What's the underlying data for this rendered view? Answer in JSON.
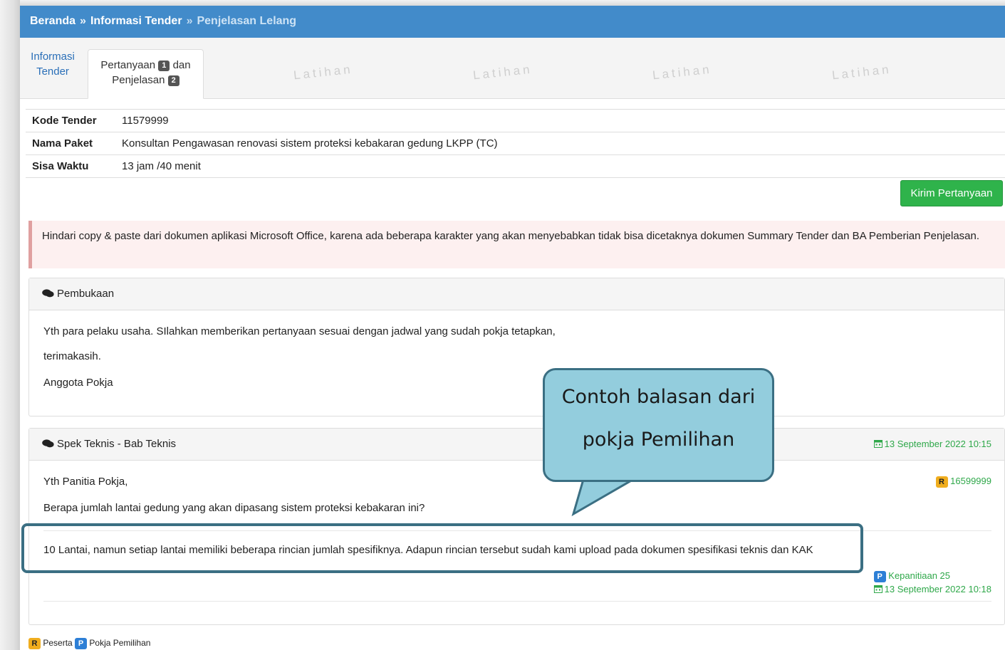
{
  "breadcrumb": {
    "home": "Beranda",
    "sep": "»",
    "section": "Informasi Tender",
    "current": "Penjelasan Lelang"
  },
  "tabs": {
    "info_line1": "Informasi",
    "info_line2": "Tender",
    "qa_part1": "Pertanyaan",
    "qa_badge1": "1",
    "qa_part2": "dan",
    "qa_part3": "Penjelasan",
    "qa_badge2": "2"
  },
  "watermark": "Latihan",
  "tender": {
    "rows": [
      {
        "key": "Kode Tender",
        "value": "11579999"
      },
      {
        "key": "Nama Paket",
        "value": "Konsultan Pengawasan renovasi sistem proteksi kebakaran gedung LKPP (TC)"
      },
      {
        "key": "Sisa Waktu",
        "value": "13 jam /40 menit"
      }
    ]
  },
  "actions": {
    "send_question": "Kirim Pertanyaan"
  },
  "alert": {
    "text": "Hindari copy & paste dari dokumen aplikasi Microsoft Office, karena ada beberapa karakter yang akan menyebabkan tidak bisa dicetaknya dokumen Summary Tender dan BA Pemberian Penjelasan."
  },
  "opening": {
    "title": "Pembukaan",
    "line1": "Yth para pelaku usaha. SIlahkan memberikan pertanyaan sesuai dengan jadwal yang sudah pokja tetapkan,",
    "line2": "terimakasih.",
    "line3": "Anggota Pokja"
  },
  "question": {
    "title": "Spek Teknis - Bab Teknis",
    "date": "13 September 2022 10:15",
    "greeting": "Yth Panitia Pokja,",
    "text": "Berapa jumlah lantai gedung yang akan dipasang sistem proteksi kebakaran ini?",
    "sender_badge": "R",
    "sender_id": "16599999",
    "answer": "10 Lantai, namun setiap lantai memiliki beberapa rincian jumlah spesifiknya. Adapun rincian tersebut sudah kami upload pada dokumen spesifikasi teknis dan KAK",
    "answer_badge": "P",
    "answer_by": "Kepanitiaan 25",
    "answer_date": "13 September 2022 10:18"
  },
  "callout": {
    "line1": "Contoh balasan dari",
    "line2": "pokja Pemilihan"
  },
  "legend": {
    "r_badge": "R",
    "r_label": "Peserta",
    "p_badge": "P",
    "p_label": "Pokja Pemilihan"
  }
}
